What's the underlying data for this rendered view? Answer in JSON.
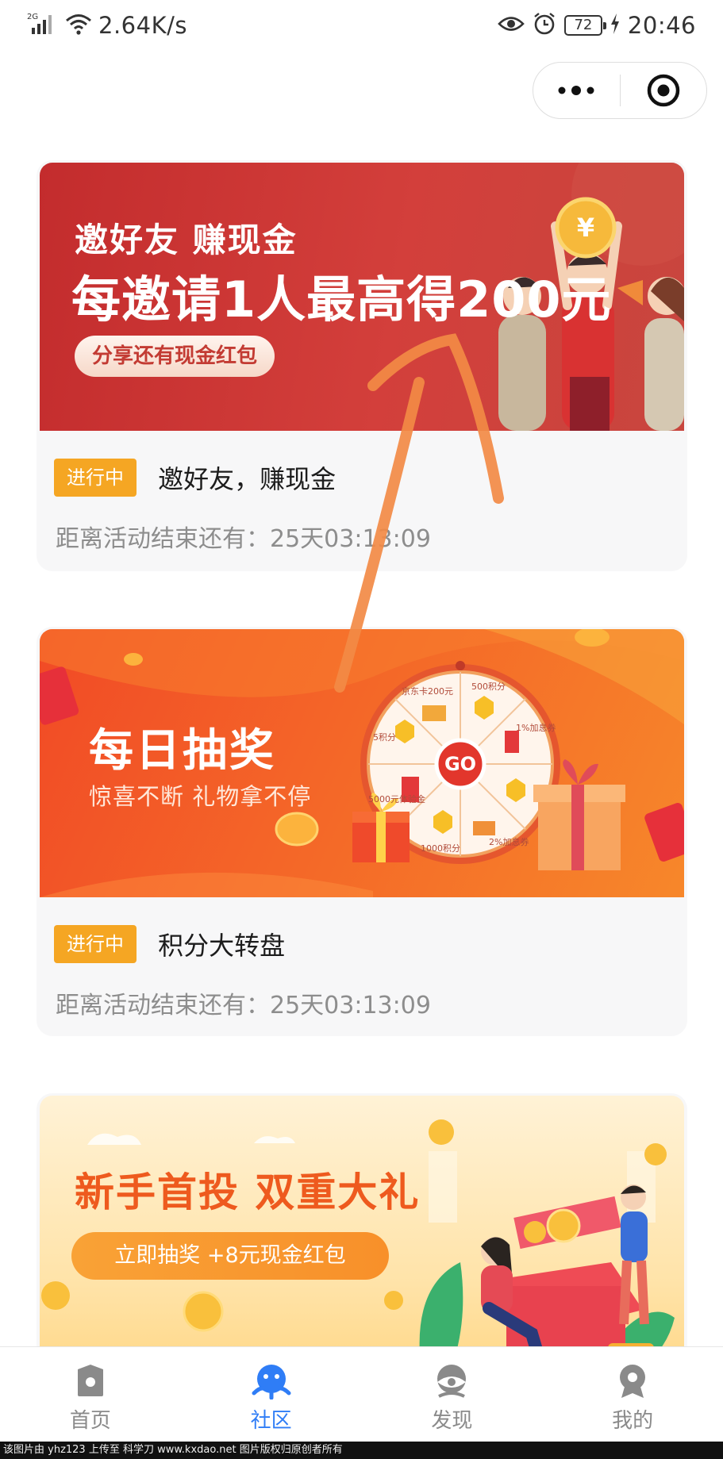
{
  "status_bar": {
    "network_type": "2G",
    "speed": "2.64K/s",
    "battery": "72",
    "time": "20:46",
    "icons": [
      "signal-icon",
      "wifi-icon",
      "eye-icon",
      "alarm-icon",
      "battery-icon",
      "charging-icon"
    ]
  },
  "capsule": {
    "icons": [
      "more-dots-icon",
      "close-target-icon"
    ]
  },
  "activities": [
    {
      "banner": {
        "subtitle": "邀好友 赚现金",
        "headline": "每邀请1人最高得200元",
        "pill": "分享还有现金红包"
      },
      "status": "进行中",
      "title": "邀好友，赚现金",
      "countdown": "距离活动结束还有：25天03:13:09"
    },
    {
      "banner": {
        "title": "每日抽奖",
        "subtitle": "惊喜不断 礼物拿不停",
        "wheel_labels": [
          "京东卡200元",
          "500积分",
          "1%加息券",
          "5积分",
          "5000元体验金",
          "1000积分",
          "2%加息券"
        ],
        "wheel_button": "GO"
      },
      "status": "进行中",
      "title": "积分大转盘",
      "countdown": "距离活动结束还有：25天03:13:09"
    },
    {
      "banner": {
        "title": "新手首投 双重大礼",
        "pill": "立即抽奖 +8元现金红包"
      }
    }
  ],
  "tab_bar": {
    "active": "社区",
    "items": [
      {
        "label": "首页",
        "icon": "home-icon"
      },
      {
        "label": "社区",
        "icon": "community-icon"
      },
      {
        "label": "发现",
        "icon": "discover-icon"
      },
      {
        "label": "我的",
        "icon": "profile-icon"
      }
    ]
  },
  "watermark": "该图片由 yhz123 上传至 科学刀 www.kxdao.net 图片版权归原创者所有",
  "colors": {
    "tag_orange": "#f5a623",
    "active_tab_blue": "#2f7df6",
    "banner1_red": "#c32c2d",
    "banner2_orange": "#f46628",
    "banner3_yellow": "#ffe3a8"
  }
}
